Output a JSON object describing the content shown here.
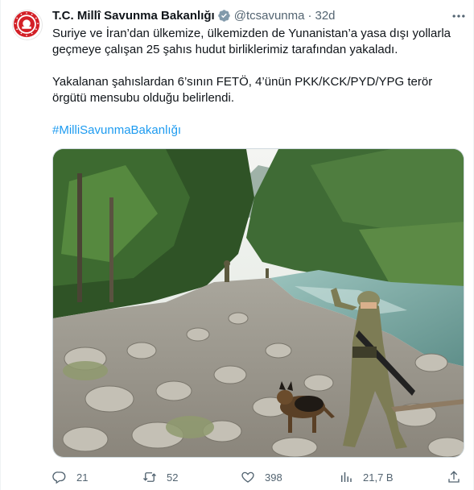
{
  "account": {
    "display_name": "T.C. Millî Savunma Bakanlığı",
    "handle": "@tcsavunma",
    "separator": "·",
    "time": "32d",
    "verified_badge": "gray-verified-badge-icon",
    "avatar_icon": "ministry-emblem-icon"
  },
  "tweet": {
    "paragraph1": "Suriye ve İran’dan ülkemize, ülkemizden de Yunanistan’a yasa dışı yollarla geçmeye çalışan 25 şahıs hudut birliklerimiz tarafından yakaladı.",
    "paragraph2": "Yakalanan şahıslardan 6’sının FETÖ, 4’ünün PKK/KCK/PYD/YPG terör örgütü mensubu olduğu belirlendi.",
    "hashtag": "#MilliSavunmaBakanlığı"
  },
  "actions": {
    "reply": {
      "icon": "reply-icon",
      "count": "21"
    },
    "retweet": {
      "icon": "retweet-icon",
      "count": "52"
    },
    "like": {
      "icon": "heart-icon",
      "count": "398"
    },
    "views": {
      "icon": "analytics-icon",
      "count": "21,7 B"
    },
    "share": {
      "icon": "share-icon"
    }
  },
  "more_icon": "more-dots-icon",
  "colors": {
    "text": "#0f1419",
    "secondary": "#536471",
    "link": "#1d9bf0",
    "emblem_red": "#d32027"
  }
}
